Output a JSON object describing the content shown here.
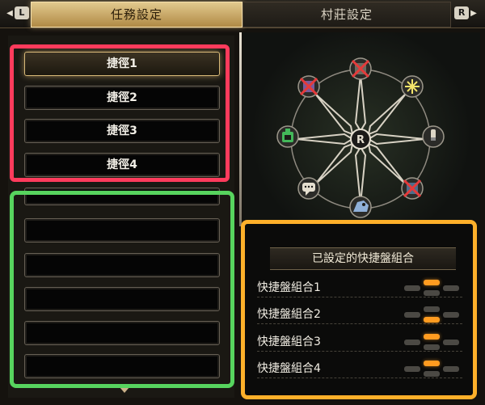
{
  "header": {
    "left_button": "L",
    "right_button": "R",
    "tabs": [
      {
        "label": "任務設定",
        "active": true
      },
      {
        "label": "村莊設定",
        "active": false
      }
    ]
  },
  "shortcuts": {
    "items": [
      {
        "label": "捷徑1",
        "selected": true
      },
      {
        "label": "捷徑2",
        "selected": false
      },
      {
        "label": "捷徑3",
        "selected": false
      },
      {
        "label": "捷徑4",
        "selected": false
      },
      {
        "label": "",
        "selected": false
      },
      {
        "label": "",
        "selected": false
      },
      {
        "label": "",
        "selected": false
      },
      {
        "label": "",
        "selected": false
      },
      {
        "label": "",
        "selected": false
      },
      {
        "label": "",
        "selected": false
      }
    ]
  },
  "wheel": {
    "center_label": "R",
    "slots": [
      {
        "icon": "crossed-out-item-icon"
      },
      {
        "icon": "starburst-icon"
      },
      {
        "icon": "potion-bottle-icon"
      },
      {
        "icon": "crossed-out-item-icon"
      },
      {
        "icon": "monster-icon"
      },
      {
        "icon": "chat-bubble-icon"
      },
      {
        "icon": "item-pouch-icon"
      },
      {
        "icon": "crossed-out-item-icon"
      }
    ]
  },
  "combos": {
    "title": "已設定的快捷盤組合",
    "items": [
      {
        "label": "快捷盤組合1",
        "active_segment": "top"
      },
      {
        "label": "快捷盤組合2",
        "active_segment": "bottom"
      },
      {
        "label": "快捷盤組合3",
        "active_segment": "top"
      },
      {
        "label": "快捷盤組合4",
        "active_segment": "top"
      }
    ]
  },
  "colors": {
    "highlight_red": "#ff3b5c",
    "highlight_green": "#57d45e",
    "highlight_orange": "#ffb02a",
    "toggle_on": "#ff9b20"
  }
}
